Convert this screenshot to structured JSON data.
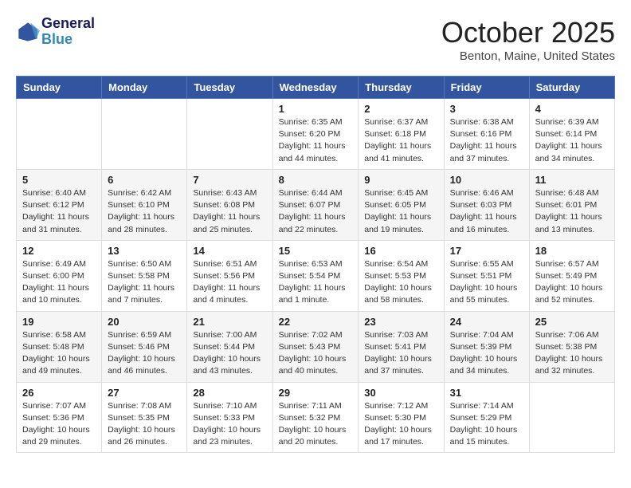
{
  "header": {
    "logo_line1": "General",
    "logo_line2": "Blue",
    "month": "October 2025",
    "location": "Benton, Maine, United States"
  },
  "weekdays": [
    "Sunday",
    "Monday",
    "Tuesday",
    "Wednesday",
    "Thursday",
    "Friday",
    "Saturday"
  ],
  "weeks": [
    [
      {
        "day": "",
        "info": ""
      },
      {
        "day": "",
        "info": ""
      },
      {
        "day": "",
        "info": ""
      },
      {
        "day": "1",
        "info": "Sunrise: 6:35 AM\nSunset: 6:20 PM\nDaylight: 11 hours\nand 44 minutes."
      },
      {
        "day": "2",
        "info": "Sunrise: 6:37 AM\nSunset: 6:18 PM\nDaylight: 11 hours\nand 41 minutes."
      },
      {
        "day": "3",
        "info": "Sunrise: 6:38 AM\nSunset: 6:16 PM\nDaylight: 11 hours\nand 37 minutes."
      },
      {
        "day": "4",
        "info": "Sunrise: 6:39 AM\nSunset: 6:14 PM\nDaylight: 11 hours\nand 34 minutes."
      }
    ],
    [
      {
        "day": "5",
        "info": "Sunrise: 6:40 AM\nSunset: 6:12 PM\nDaylight: 11 hours\nand 31 minutes."
      },
      {
        "day": "6",
        "info": "Sunrise: 6:42 AM\nSunset: 6:10 PM\nDaylight: 11 hours\nand 28 minutes."
      },
      {
        "day": "7",
        "info": "Sunrise: 6:43 AM\nSunset: 6:08 PM\nDaylight: 11 hours\nand 25 minutes."
      },
      {
        "day": "8",
        "info": "Sunrise: 6:44 AM\nSunset: 6:07 PM\nDaylight: 11 hours\nand 22 minutes."
      },
      {
        "day": "9",
        "info": "Sunrise: 6:45 AM\nSunset: 6:05 PM\nDaylight: 11 hours\nand 19 minutes."
      },
      {
        "day": "10",
        "info": "Sunrise: 6:46 AM\nSunset: 6:03 PM\nDaylight: 11 hours\nand 16 minutes."
      },
      {
        "day": "11",
        "info": "Sunrise: 6:48 AM\nSunset: 6:01 PM\nDaylight: 11 hours\nand 13 minutes."
      }
    ],
    [
      {
        "day": "12",
        "info": "Sunrise: 6:49 AM\nSunset: 6:00 PM\nDaylight: 11 hours\nand 10 minutes."
      },
      {
        "day": "13",
        "info": "Sunrise: 6:50 AM\nSunset: 5:58 PM\nDaylight: 11 hours\nand 7 minutes."
      },
      {
        "day": "14",
        "info": "Sunrise: 6:51 AM\nSunset: 5:56 PM\nDaylight: 11 hours\nand 4 minutes."
      },
      {
        "day": "15",
        "info": "Sunrise: 6:53 AM\nSunset: 5:54 PM\nDaylight: 11 hours\nand 1 minute."
      },
      {
        "day": "16",
        "info": "Sunrise: 6:54 AM\nSunset: 5:53 PM\nDaylight: 10 hours\nand 58 minutes."
      },
      {
        "day": "17",
        "info": "Sunrise: 6:55 AM\nSunset: 5:51 PM\nDaylight: 10 hours\nand 55 minutes."
      },
      {
        "day": "18",
        "info": "Sunrise: 6:57 AM\nSunset: 5:49 PM\nDaylight: 10 hours\nand 52 minutes."
      }
    ],
    [
      {
        "day": "19",
        "info": "Sunrise: 6:58 AM\nSunset: 5:48 PM\nDaylight: 10 hours\nand 49 minutes."
      },
      {
        "day": "20",
        "info": "Sunrise: 6:59 AM\nSunset: 5:46 PM\nDaylight: 10 hours\nand 46 minutes."
      },
      {
        "day": "21",
        "info": "Sunrise: 7:00 AM\nSunset: 5:44 PM\nDaylight: 10 hours\nand 43 minutes."
      },
      {
        "day": "22",
        "info": "Sunrise: 7:02 AM\nSunset: 5:43 PM\nDaylight: 10 hours\nand 40 minutes."
      },
      {
        "day": "23",
        "info": "Sunrise: 7:03 AM\nSunset: 5:41 PM\nDaylight: 10 hours\nand 37 minutes."
      },
      {
        "day": "24",
        "info": "Sunrise: 7:04 AM\nSunset: 5:39 PM\nDaylight: 10 hours\nand 34 minutes."
      },
      {
        "day": "25",
        "info": "Sunrise: 7:06 AM\nSunset: 5:38 PM\nDaylight: 10 hours\nand 32 minutes."
      }
    ],
    [
      {
        "day": "26",
        "info": "Sunrise: 7:07 AM\nSunset: 5:36 PM\nDaylight: 10 hours\nand 29 minutes."
      },
      {
        "day": "27",
        "info": "Sunrise: 7:08 AM\nSunset: 5:35 PM\nDaylight: 10 hours\nand 26 minutes."
      },
      {
        "day": "28",
        "info": "Sunrise: 7:10 AM\nSunset: 5:33 PM\nDaylight: 10 hours\nand 23 minutes."
      },
      {
        "day": "29",
        "info": "Sunrise: 7:11 AM\nSunset: 5:32 PM\nDaylight: 10 hours\nand 20 minutes."
      },
      {
        "day": "30",
        "info": "Sunrise: 7:12 AM\nSunset: 5:30 PM\nDaylight: 10 hours\nand 17 minutes."
      },
      {
        "day": "31",
        "info": "Sunrise: 7:14 AM\nSunset: 5:29 PM\nDaylight: 10 hours\nand 15 minutes."
      },
      {
        "day": "",
        "info": ""
      }
    ]
  ]
}
